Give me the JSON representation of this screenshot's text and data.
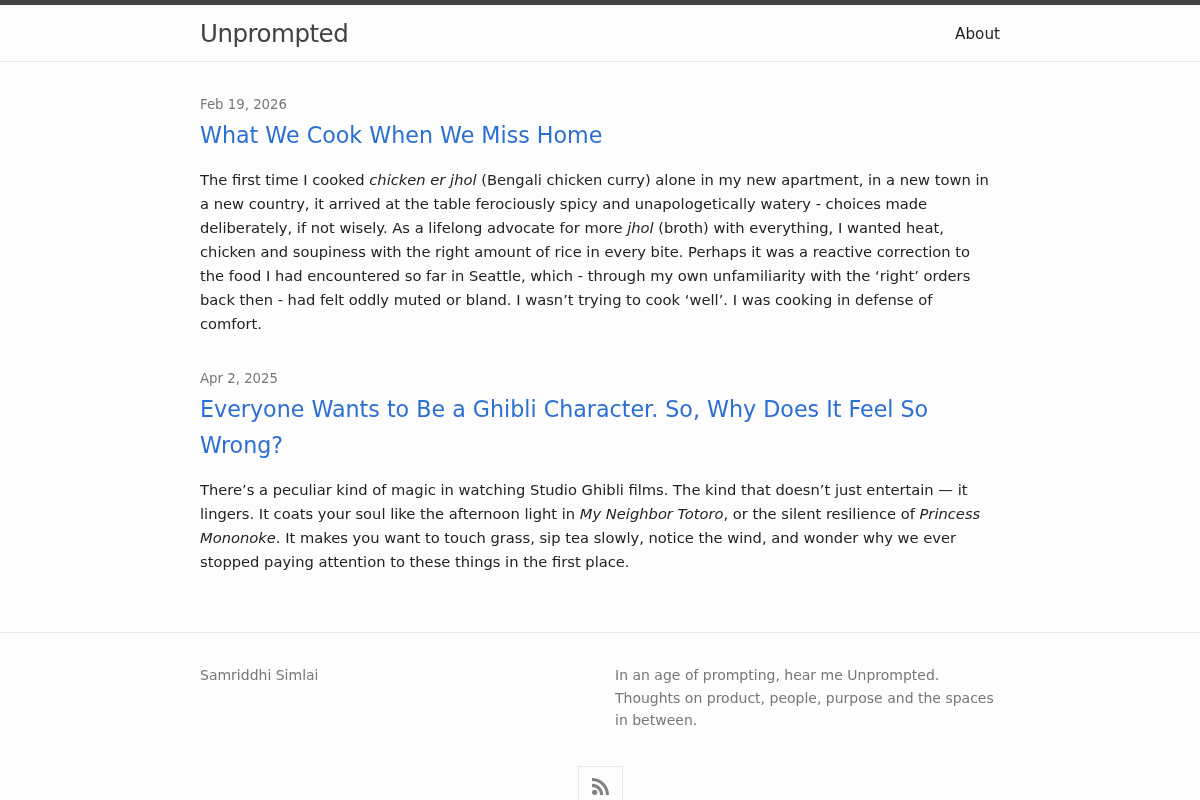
{
  "header": {
    "site_title": "Unprompted",
    "nav": [
      {
        "label": "About"
      }
    ]
  },
  "posts": [
    {
      "date": "Feb 19, 2026",
      "title": "What We Cook When We Miss Home",
      "excerpt": "The first time I cooked *chicken er jhol* (Bengali chicken curry) alone in my new apartment, in a new town in a new country, it arrived at the table ferociously spicy and unapologetically watery - choices made deliberately, if not wisely. As a lifelong advocate for more *jhol* (broth) with everything, I wanted heat, chicken and soupiness with the right amount of rice in every bite. Perhaps it was a reactive correction to the food I had encountered so far in Seattle, which - through my own unfamiliarity with the ‘right’ orders back then - had felt oddly muted or bland. I wasn’t trying to cook ‘well’. I was cooking in defense of comfort."
    },
    {
      "date": "Apr 2, 2025",
      "title": "Everyone Wants to Be a Ghibli Character. So, Why Does It Feel So Wrong?",
      "excerpt": "There’s a peculiar kind of magic in watching Studio Ghibli films. The kind that doesn’t just entertain — it lingers. It coats your soul like the afternoon light in *My Neighbor Totoro*, or the silent resilience of *Princess Mononoke*. It makes you want to touch grass, sip tea slowly, notice the wind, and wonder why we ever stopped paying attention to these things in the first place."
    }
  ],
  "footer": {
    "author": "Samriddhi Simlai",
    "description": "In an age of prompting, hear me Unprompted. Thoughts on product, people, purpose and the spaces in between."
  }
}
